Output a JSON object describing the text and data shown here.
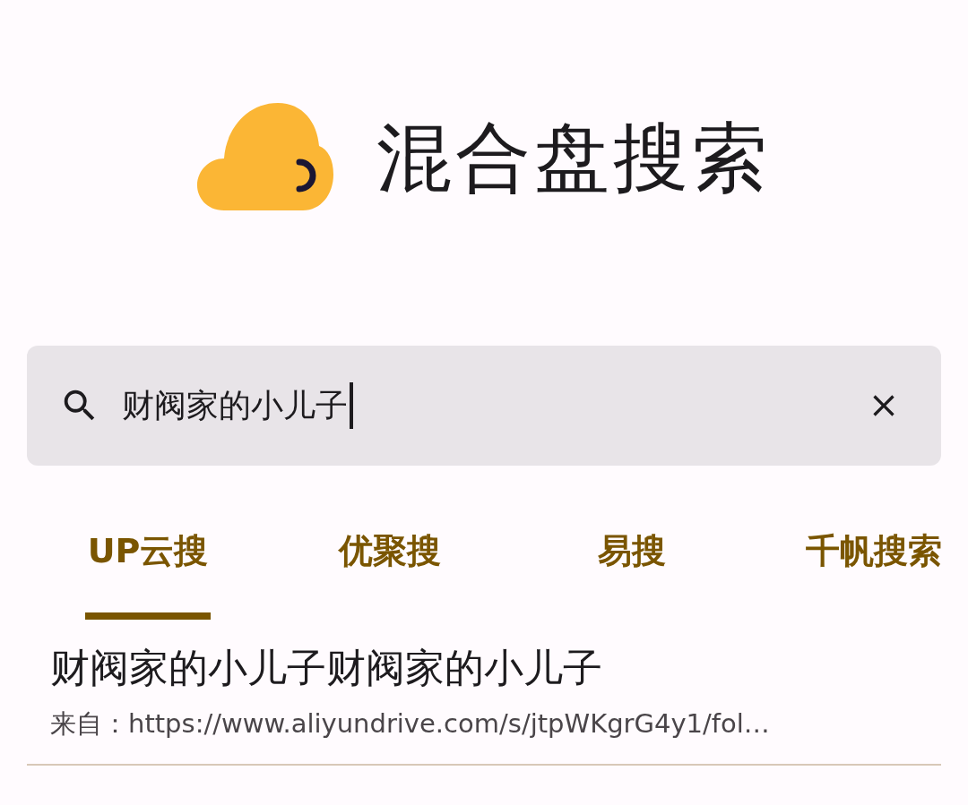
{
  "app": {
    "title": "混合盘搜索"
  },
  "search": {
    "value": "财阀家的小儿子"
  },
  "tabs": [
    {
      "label": "UP云搜",
      "selected": true
    },
    {
      "label": "优聚搜",
      "selected": false
    },
    {
      "label": "易搜",
      "selected": false
    },
    {
      "label": "千帆搜索",
      "selected": false
    }
  ],
  "results": [
    {
      "title": "财阀家的小儿子财阀家的小儿子",
      "source": "来自：https://www.aliyundrive.com/s/jtpWKgrG4y1/fol…"
    }
  ]
}
